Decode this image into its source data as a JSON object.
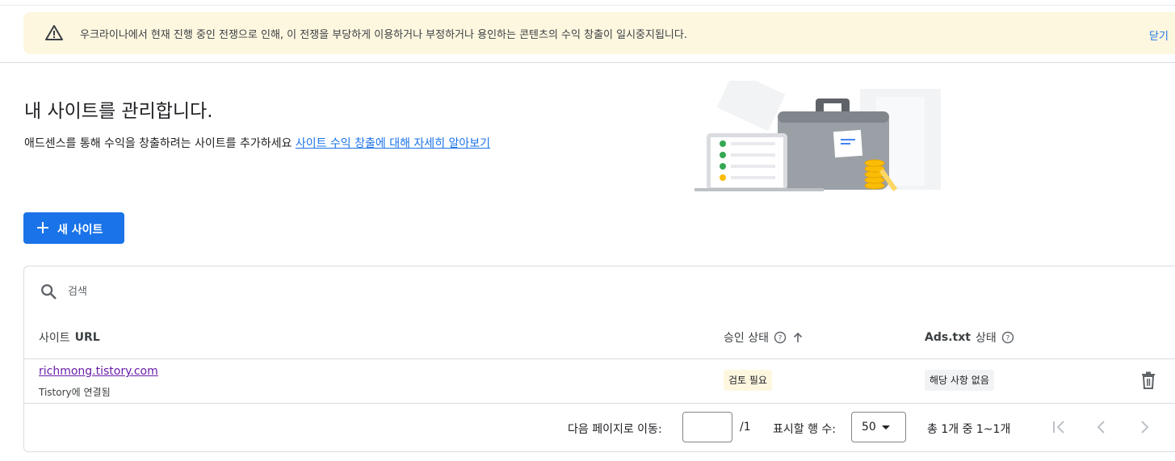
{
  "banner": {
    "message": "우크라이나에서 현재 진행 중인 전쟁으로 인해, 이 전쟁을 부당하게 이용하거나 부정하거나 용인하는 콘텐츠의 수익 창출이 일시중지됩니다.",
    "close_label": "닫기"
  },
  "header": {
    "title": "내 사이트를 관리합니다.",
    "description": "애드센스를 통해 수익을 창출하려는 사이트를 추가하세요",
    "learn_more_link": "사이트 수익 창출에 대해 자세히 알아보기"
  },
  "actions": {
    "new_site_label": "새 사이트"
  },
  "table": {
    "search_placeholder": "검색",
    "columns": {
      "site_url_prefix": "사이트",
      "site_url_bold": "URL",
      "approval_status": "승인 상태",
      "ads_txt_bold": "Ads.txt",
      "ads_txt_suffix": "상태"
    },
    "rows": [
      {
        "url": "richmong.tistory.com",
        "subtitle": "Tistory에 연결됨",
        "approval_status": "검토 필요",
        "ads_txt_status": "해당 사항 없음"
      }
    ]
  },
  "pagination": {
    "goto_label": "다음 페이지로 이동:",
    "page_value": "",
    "total_pages": "/1",
    "rows_label": "표시할 행 수:",
    "rows_value": "50",
    "range_text": "총 1개 중 1~1개"
  },
  "colors": {
    "primary": "#1a73e8",
    "banner_bg": "#fef7e0",
    "visited_link": "#681da8"
  }
}
